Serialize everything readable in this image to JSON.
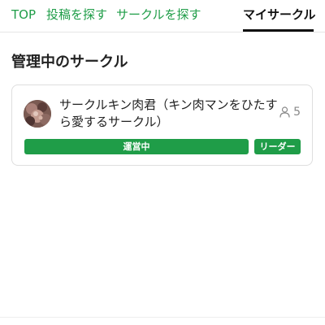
{
  "tabs": [
    {
      "label": "TOP"
    },
    {
      "label": "投稿を探す"
    },
    {
      "label": "サークルを探す"
    },
    {
      "label": "マイサークル",
      "active": true
    }
  ],
  "section": {
    "title": "管理中のサークル"
  },
  "circles": [
    {
      "name": "サークルキン肉君（キン肉マンをひたすら愛するサークル）",
      "member_count": "5",
      "member_icon": "person-icon",
      "status_label": "運営中",
      "role_label": "リーダー"
    }
  ],
  "colors": {
    "accent": "#1f9d48",
    "active_tab": "#111111",
    "muted": "#888888",
    "border": "#dedede"
  }
}
